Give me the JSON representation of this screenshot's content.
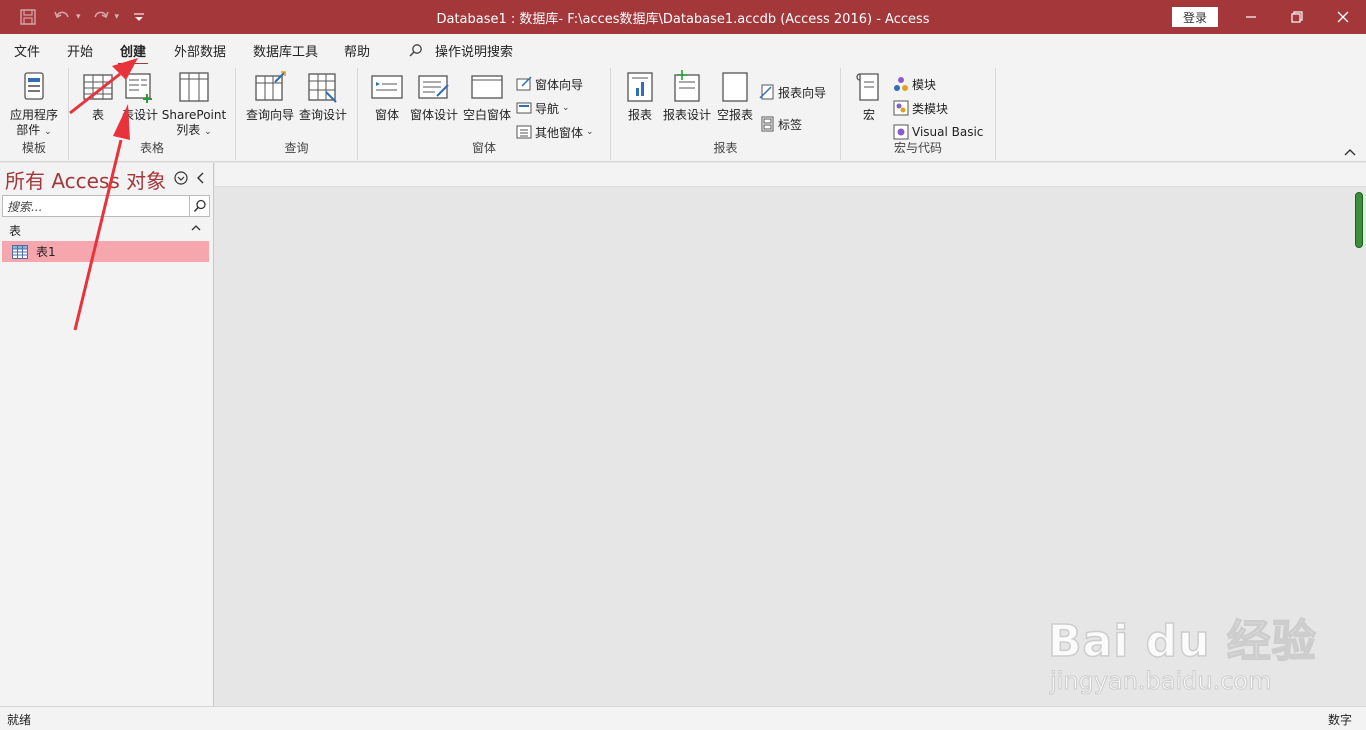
{
  "window": {
    "title": "Database1 : 数据库- F:\\acces数据库\\Database1.accdb (Access 2016)  -  Access",
    "login": "登录"
  },
  "tabs": [
    "文件",
    "开始",
    "创建",
    "外部数据",
    "数据库工具",
    "帮助"
  ],
  "active_tab": "创建",
  "tellme": "操作说明搜索",
  "ribbon": {
    "templates": {
      "app_parts_line1": "应用程序",
      "app_parts_line2": "部件",
      "label": "模板"
    },
    "tables": {
      "table": "表",
      "table_design": "表设计",
      "sharepoint_line1": "SharePoint",
      "sharepoint_line2": "列表",
      "label": "表格"
    },
    "queries": {
      "wizard": "查询向导",
      "design": "查询设计",
      "label": "查询"
    },
    "forms": {
      "form": "窗体",
      "form_design": "窗体设计",
      "blank_form": "空白窗体",
      "form_wizard": "窗体向导",
      "navigation": "导航",
      "more_forms": "其他窗体",
      "label": "窗体"
    },
    "reports": {
      "report": "报表",
      "report_design": "报表设计",
      "blank_report": "空报表",
      "report_wizard": "报表向导",
      "labels": "标签",
      "label": "报表"
    },
    "macros": {
      "macro": "宏",
      "module": "模块",
      "class_module": "类模块",
      "visual_basic": "Visual Basic",
      "label": "宏与代码"
    }
  },
  "nav": {
    "title": "所有 Access 对象",
    "search_placeholder": "搜索...",
    "group": "表",
    "items": [
      "表1"
    ]
  },
  "status": {
    "left": "就绪",
    "right": "数字"
  },
  "watermark": {
    "main": "Bai du 经验",
    "sub": "jingyan.baidu.com"
  },
  "colors": {
    "accent": "#a4373a",
    "selected_item": "#f6a7ad",
    "annotation": "#e8323c"
  }
}
